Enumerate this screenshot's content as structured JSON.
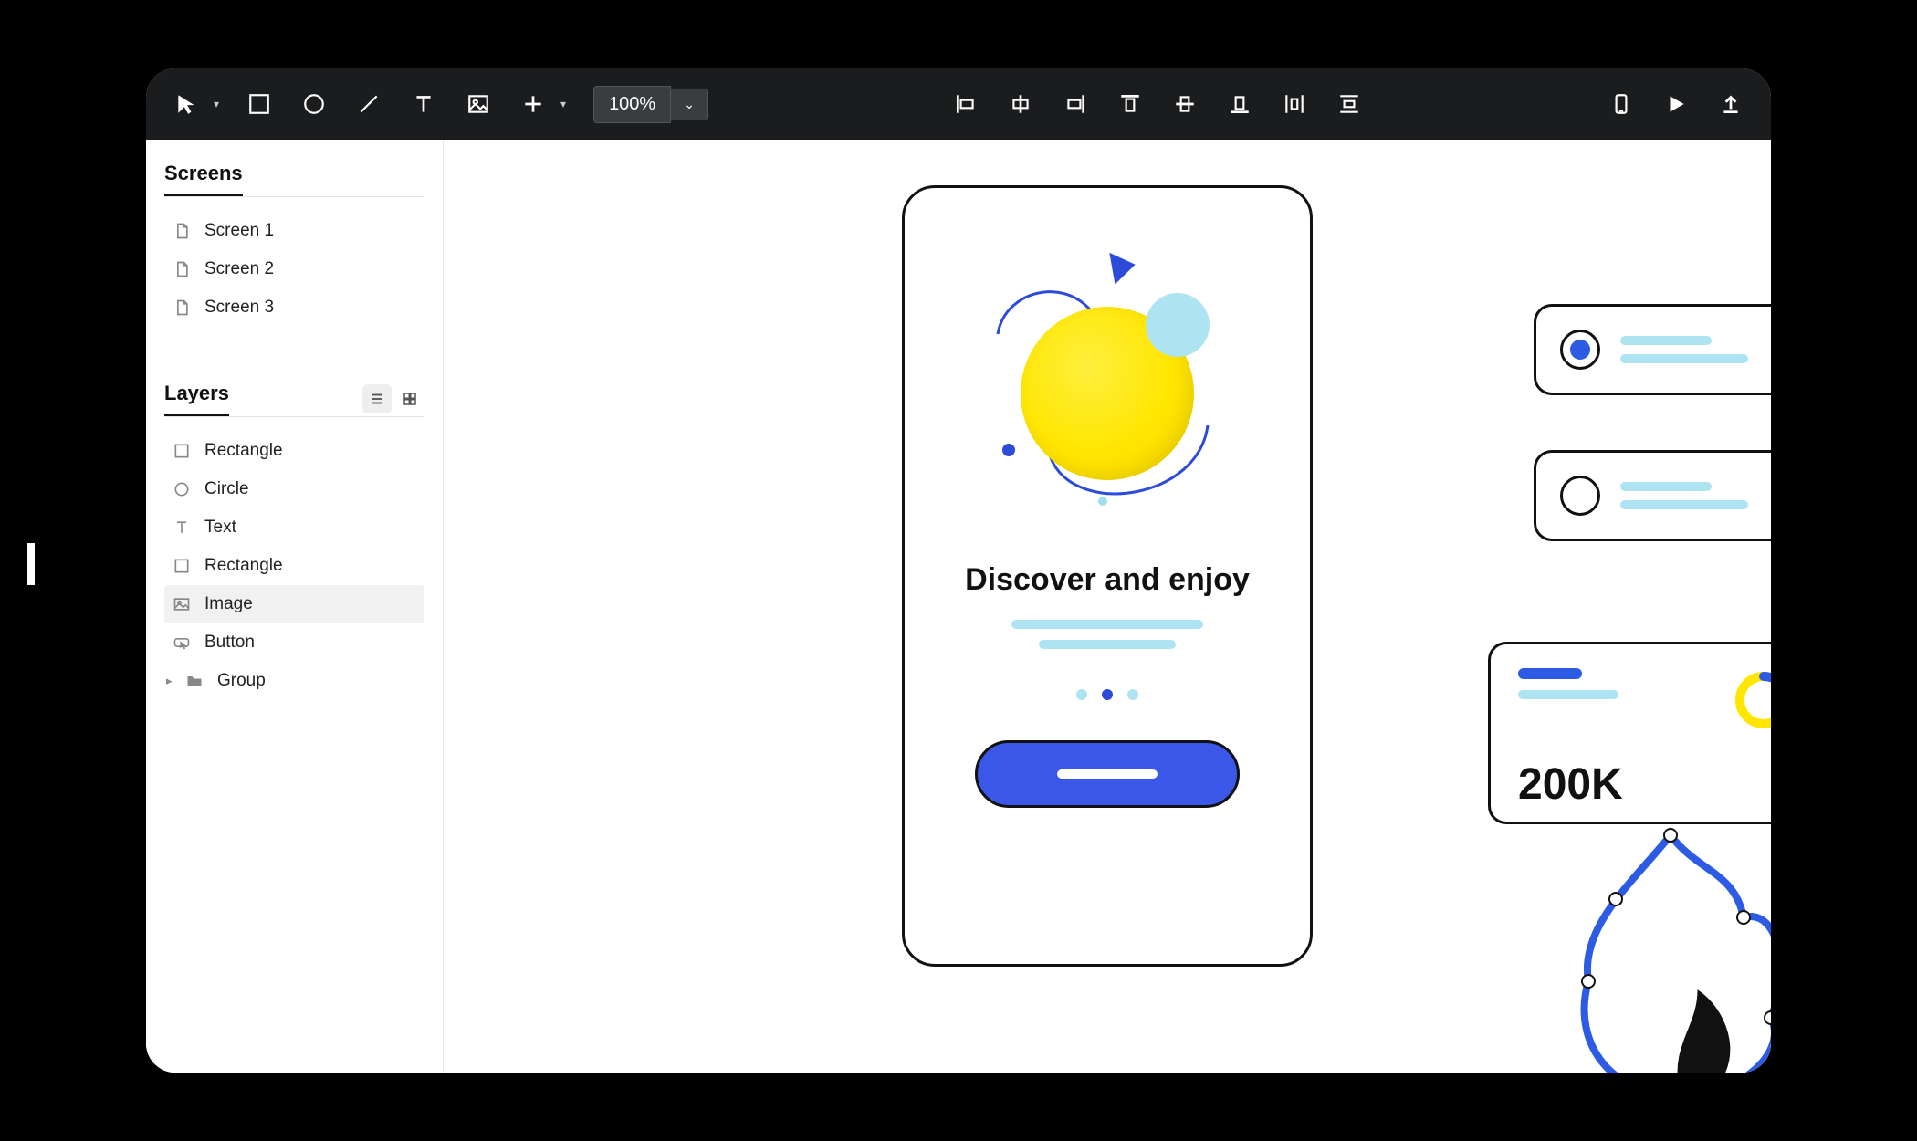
{
  "toolbar": {
    "zoom": "100%"
  },
  "sidebar": {
    "screens_title": "Screens",
    "screens": [
      {
        "label": "Screen 1"
      },
      {
        "label": "Screen 2"
      },
      {
        "label": "Screen 3"
      }
    ],
    "layers_title": "Layers",
    "layers": [
      {
        "label": "Rectangle",
        "icon": "rectangle",
        "selected": false
      },
      {
        "label": "Circle",
        "icon": "circle",
        "selected": false
      },
      {
        "label": "Text",
        "icon": "text",
        "selected": false
      },
      {
        "label": "Rectangle",
        "icon": "rectangle",
        "selected": false
      },
      {
        "label": "Image",
        "icon": "image",
        "selected": true
      },
      {
        "label": "Button",
        "icon": "button",
        "selected": false
      },
      {
        "label": "Group",
        "icon": "folder",
        "selected": false,
        "expandable": true
      }
    ]
  },
  "canvas": {
    "headline": "Discover and enjoy",
    "pager_active_index": 1,
    "pager_count": 3
  },
  "cards": {
    "radio_selected_index": 0,
    "stat_value": "200K"
  },
  "colors": {
    "accent_blue": "#2d5be3",
    "accent_yellow": "#ffe600",
    "accent_cyan": "#aee3f2"
  }
}
